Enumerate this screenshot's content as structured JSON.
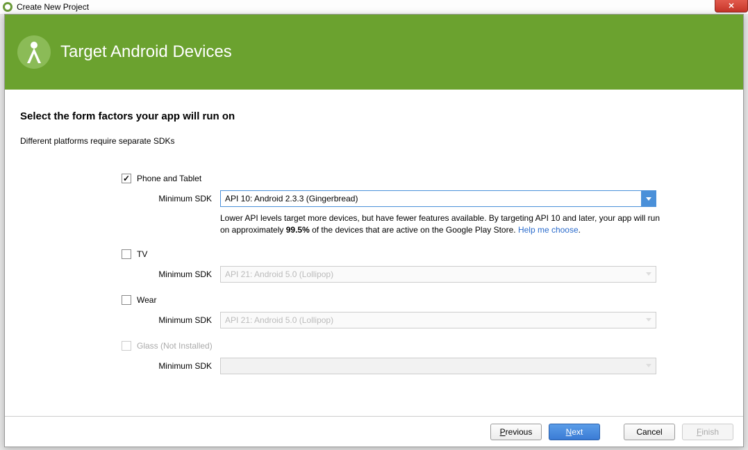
{
  "titlebar": {
    "title": "Create New Project"
  },
  "banner": {
    "title": "Target Android Devices"
  },
  "heading": "Select the form factors your app will run on",
  "subheading": "Different platforms require separate SDKs",
  "formFactors": {
    "phoneTablet": {
      "label": "Phone and Tablet",
      "checked": true,
      "sdkLabel": "Minimum SDK",
      "sdkValue": "API 10: Android 2.3.3 (Gingerbread)",
      "hint_pre": "Lower API levels target more devices, but have fewer features available. By targeting API 10 and later, your app will run on approximately ",
      "hint_percent": "99.5%",
      "hint_post": " of the devices that are active on the Google Play Store. ",
      "hint_link": "Help me choose"
    },
    "tv": {
      "label": "TV",
      "checked": false,
      "sdkLabel": "Minimum SDK",
      "sdkValue": "API 21: Android 5.0 (Lollipop)"
    },
    "wear": {
      "label": "Wear",
      "checked": false,
      "sdkLabel": "Minimum SDK",
      "sdkValue": "API 21: Android 5.0 (Lollipop)"
    },
    "glass": {
      "label": "Glass (Not Installed)",
      "checked": false,
      "sdkLabel": "Minimum SDK",
      "sdkValue": ""
    }
  },
  "buttons": {
    "previous": "Previous",
    "next": "Next",
    "cancel": "Cancel",
    "finish": "Finish"
  }
}
